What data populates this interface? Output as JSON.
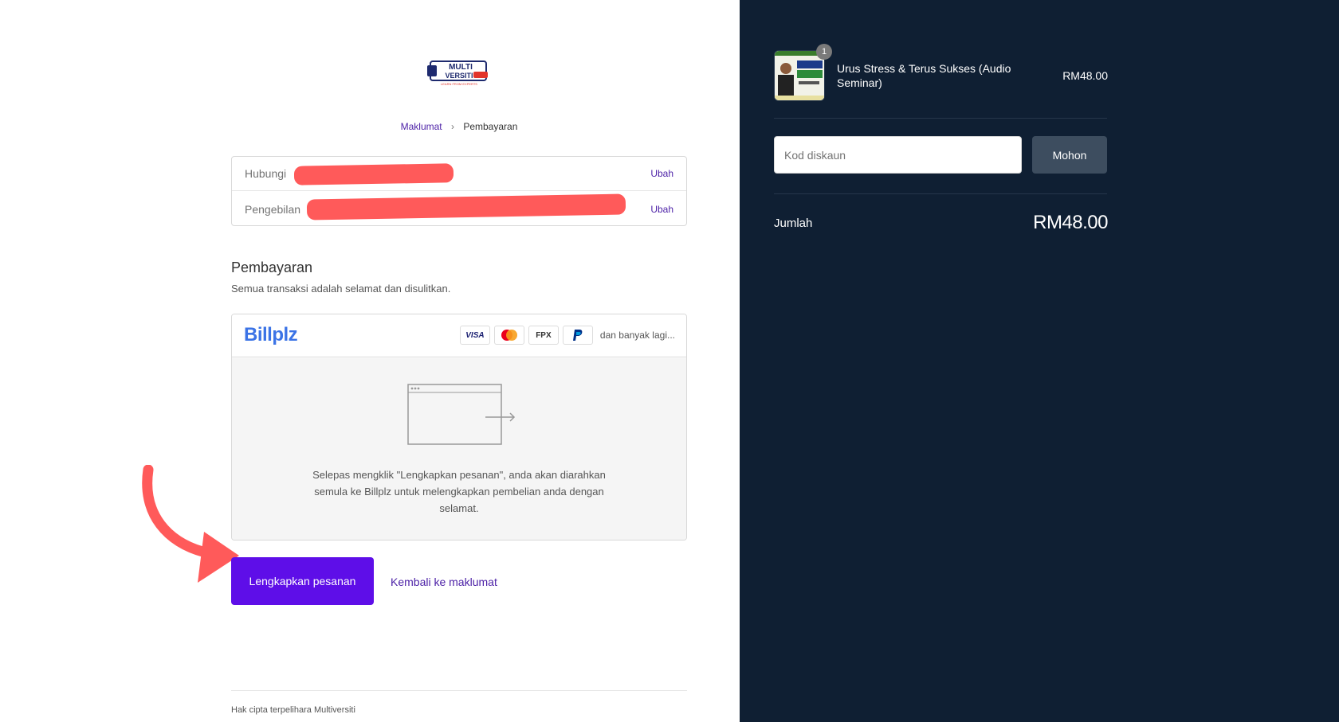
{
  "logo": {
    "text": "MULTI VERSITI",
    "tagline": "LEARN FROM EXPERTS"
  },
  "breadcrumb": {
    "step1": "Maklumat",
    "separator": "›",
    "step2": "Pembayaran"
  },
  "info": {
    "contact_label": "Hubungi",
    "billing_label": "Pengebilan",
    "change_label": "Ubah"
  },
  "payment": {
    "title": "Pembayaran",
    "subtitle": "Semua transaksi adalah selamat dan disulitkan.",
    "provider": "Billplz",
    "cards": [
      "VISA",
      "mastercard",
      "FPX",
      "paypal"
    ],
    "more_text": "dan banyak lagi...",
    "redirect_text": "Selepas mengklik \"Lengkapkan pesanan\", anda akan diarahkan semula ke Billplz untuk melengkapkan pembelian anda dengan selamat."
  },
  "actions": {
    "complete_label": "Lengkapkan pesanan",
    "back_label": "Kembali ke maklumat"
  },
  "footer": {
    "text": "Hak cipta terpelihara Multiversiti"
  },
  "summary": {
    "product_name": "Urus Stress & Terus Sukses (Audio Seminar)",
    "product_price": "RM48.00",
    "quantity": "1",
    "discount_placeholder": "Kod diskaun",
    "apply_label": "Mohon",
    "total_label": "Jumlah",
    "total_value": "RM48.00"
  },
  "colors": {
    "accent": "#5e0ee8",
    "link": "#4b1fa6",
    "sidebar_bg": "#0f1f33",
    "annotation": "#ff5a5a"
  }
}
